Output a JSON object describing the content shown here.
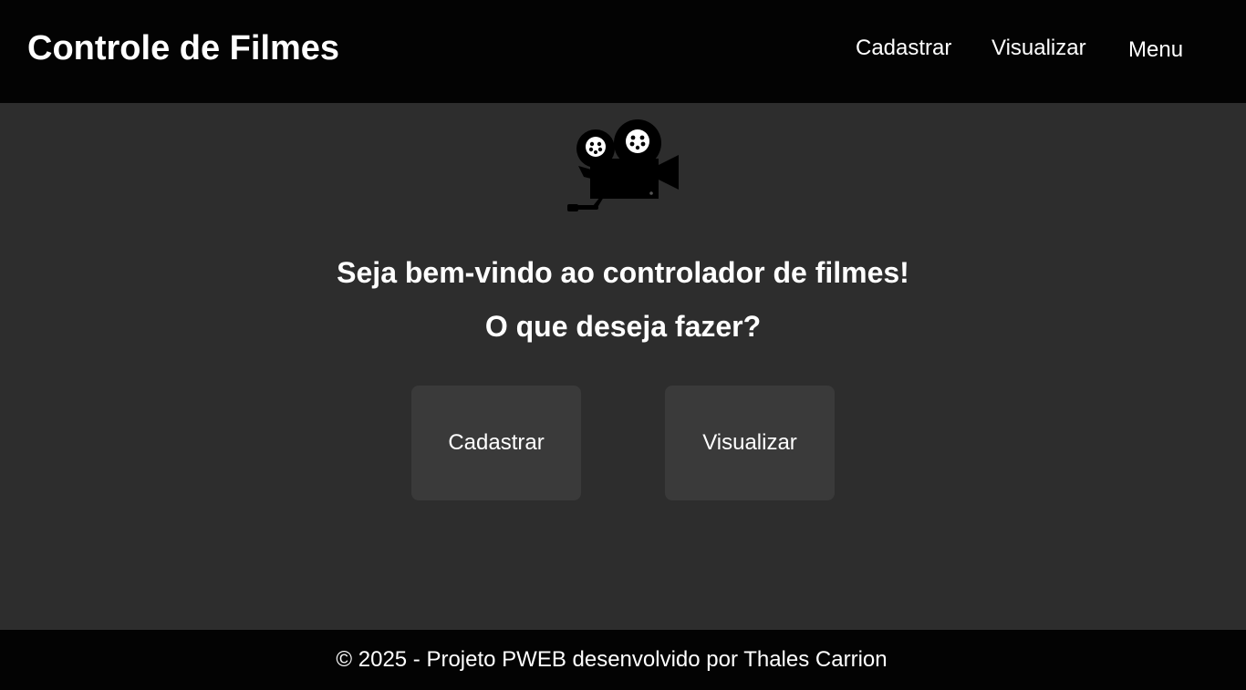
{
  "header": {
    "title": "Controle de Filmes",
    "nav": {
      "cadastrar": "Cadastrar",
      "visualizar": "Visualizar",
      "menu": "Menu"
    }
  },
  "main": {
    "logo_icon": "movie-camera-icon",
    "welcome": "Seja bem-vindo ao controlador de filmes!",
    "question": "O que deseja fazer?",
    "buttons": {
      "cadastrar": "Cadastrar",
      "visualizar": "Visualizar"
    }
  },
  "footer": {
    "text": "© 2025 - Projeto PWEB desenvolvido por Thales Carrion"
  },
  "colors": {
    "header_bg": "#030303",
    "page_bg": "#2d2d2d",
    "button_bg": "#3a3a3a",
    "text": "#ffffff"
  }
}
